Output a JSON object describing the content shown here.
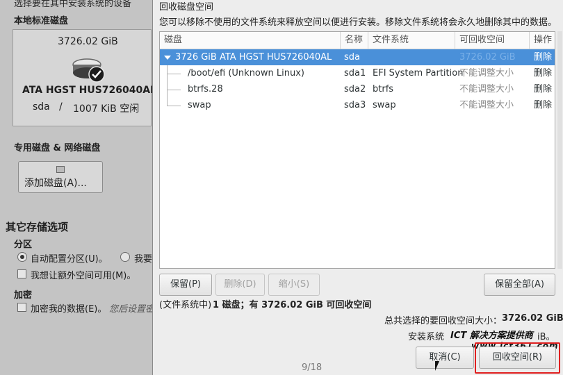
{
  "background": {
    "header_fragment": "选择要在其中安装系统的设备",
    "local_disks_label": "本地标准磁盘",
    "disk": {
      "size": "3726.02 GiB",
      "model": "ATA HGST HUS726040AL",
      "name": "sda",
      "sep": "/",
      "free": "1007 KiB 空闲"
    },
    "special_disks_label": "专用磁盘 & 网络磁盘",
    "add_disk_label": "添加磁盘(A)...",
    "other_options_title": "其它存储选项",
    "partition_label": "分区",
    "auto_partition": "自动配置分区(U)。",
    "manual_partition_fragment": "我要",
    "extra_space": "我想让额外空间可用(M)。",
    "encrypt_label": "加密",
    "encrypt_data": "加密我的数据(E)。",
    "encrypt_hint": "您后设置密"
  },
  "dialog": {
    "title": "回收磁盘空间",
    "description": "您可以移除不使用的文件系统来释放空间以便进行安装。移除文件系统将会永久地删除其中的数据。",
    "columns": {
      "disk": "磁盘",
      "name": "名称",
      "filesystem": "文件系统",
      "reclaimable": "可回收空间",
      "action": "操作"
    },
    "rows": [
      {
        "disk": "3726 GiB ATA HGST HUS726040AL",
        "name": "sda",
        "filesystem": "",
        "reclaimable": "3726.02 GiB",
        "action": "删除"
      },
      {
        "disk": "/boot/efi (Unknown Linux)",
        "name": "sda1",
        "filesystem": "EFI System Partition",
        "reclaimable": "不能调整大小",
        "action": "删除"
      },
      {
        "disk": "btrfs.28",
        "name": "sda2",
        "filesystem": "btrfs",
        "reclaimable": "不能调整大小",
        "action": "删除"
      },
      {
        "disk": "swap",
        "name": "sda3",
        "filesystem": "swap",
        "reclaimable": "不能调整大小",
        "action": "删除"
      }
    ],
    "buttons": {
      "preserve": "保留(P)",
      "delete": "删除(D)",
      "shrink": "缩小(S)",
      "preserve_all": "保留全部(A)",
      "cancel": "取消(C)",
      "reclaim": "回收空间(R)"
    },
    "summary_prefix": "(文件系统中)",
    "summary_bold": "1 磁盘；有 3726.02 GiB 可回收空间",
    "total_selected_label": "总共选择的要回收空间大小：",
    "total_selected_value": "3726.02 GiB",
    "install_label": "安装系统",
    "install_suffix": "iB。",
    "page_number": "9/18"
  },
  "watermark": {
    "line1": "ICT 解决方案提供商",
    "line2": "www.ict361.com"
  },
  "colors": {
    "selection": "#4a90d9",
    "highlight_box": "#e02020"
  }
}
